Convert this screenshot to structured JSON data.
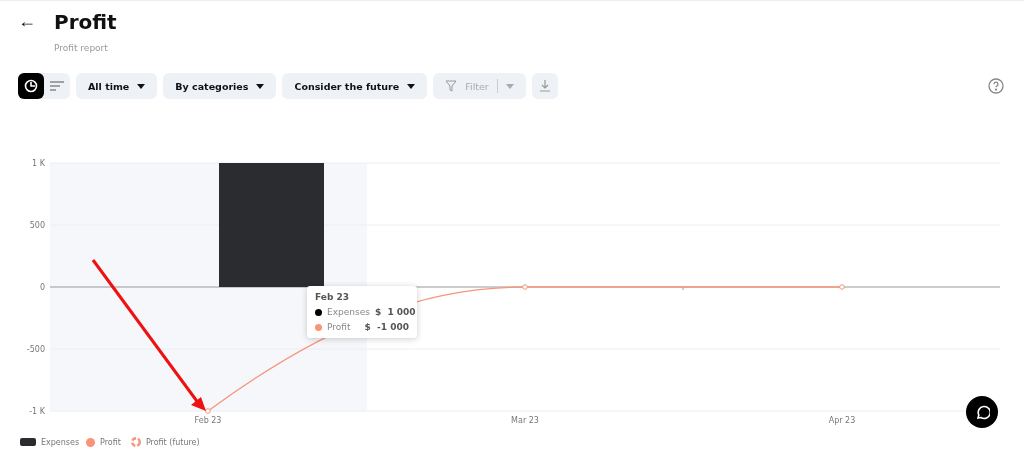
{
  "header": {
    "back": "←",
    "title": "Profit",
    "subtitle": "Profit report"
  },
  "toolbar": {
    "view_toggle": [
      {
        "kind": "chart",
        "selected": true
      },
      {
        "kind": "list",
        "selected": false
      }
    ],
    "dropdowns": [
      {
        "label": "All time",
        "disabled": false
      },
      {
        "label": "By categories",
        "disabled": false
      },
      {
        "label": "Consider the future",
        "disabled": false
      },
      {
        "label": "Filter",
        "disabled": true
      }
    ],
    "download": {
      "kind": "download"
    },
    "help": {
      "kind": "help"
    }
  },
  "chart": {
    "bars": {
      "chart_data": {
        "type": "bar",
        "categories": [
          "Feb 23",
          "Mar 23",
          "Apr 23"
        ],
        "series": [
          {
            "name": "Expenses",
            "color": "#2b2c30",
            "values": [
              1000,
              0,
              0
            ]
          }
        ],
        "ylim": [
          -1000,
          1000
        ],
        "yticks": [
          {
            "value": 1000,
            "label": "1 K"
          },
          {
            "value": 500,
            "label": "500"
          },
          {
            "value": 0,
            "label": "0"
          },
          {
            "value": -500,
            "label": "-500"
          },
          {
            "value": -1000,
            "label": "-1 K"
          }
        ]
      }
    },
    "line": {
      "chart_data": {
        "type": "line",
        "series": [
          {
            "name": "Profit",
            "color": "#f7957a",
            "marker": "o",
            "values": [
              -1000,
              0,
              0
            ]
          }
        ],
        "ylim": [
          -1000,
          1000
        ]
      }
    },
    "hover_band": true,
    "arrow": {
      "color": "#ee1111"
    },
    "tooltip": {
      "title": "Feb 23",
      "rows": [
        {
          "label": "Expenses",
          "value": "$  1 000",
          "color": "#000000"
        },
        {
          "label": "Profit",
          "value": "$  -1 000",
          "color": "#f7957a"
        }
      ]
    },
    "legend_future": {
      "label": "Profit (future)",
      "color": "#f7957a"
    }
  },
  "chat_button": {
    "kind": "chat"
  }
}
